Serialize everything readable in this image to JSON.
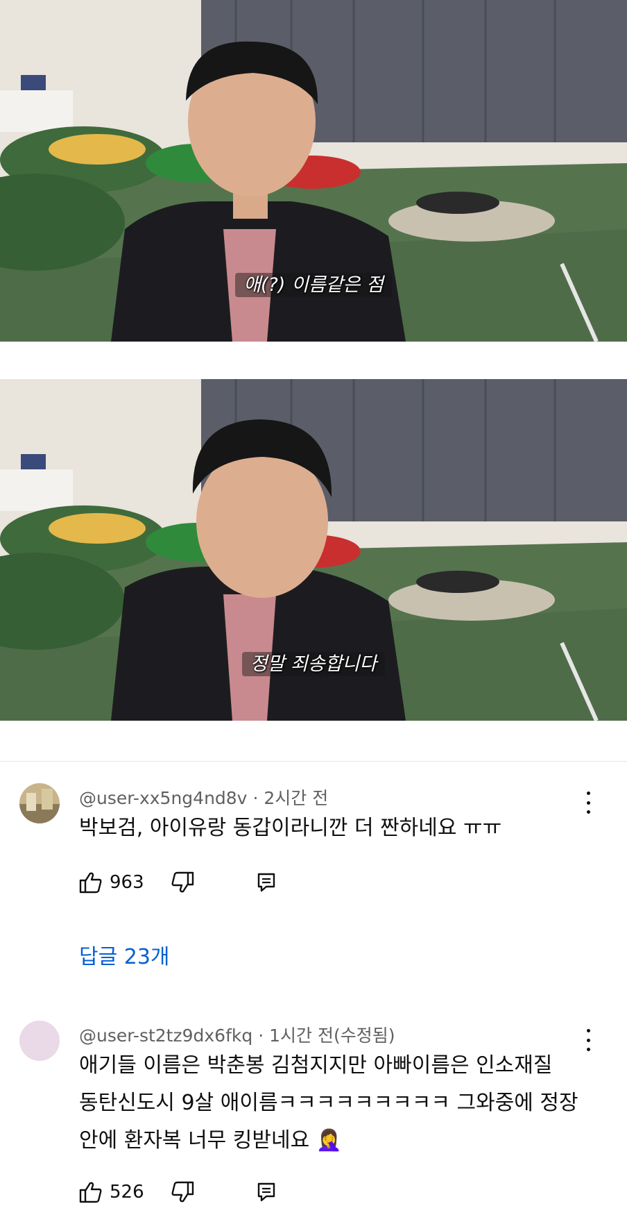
{
  "video_frames": [
    {
      "subtitle": "애(?) 이름같은 점"
    },
    {
      "subtitle": "정말 죄송합니다"
    }
  ],
  "comments": [
    {
      "author": "@user-xx5ng4nd8v",
      "separator": "·",
      "time": "2시간 전",
      "text_lines": [
        "박보검, 아이유랑 동갑이라니깐 더 짠하네요 ㅠㅠ"
      ],
      "likes": "963",
      "replies_label": "답글 23개"
    },
    {
      "author": "@user-st2tz9dx6fkq",
      "separator": "·",
      "time": "1시간 전(수정됨)",
      "text_lines": [
        "애기들 이름은 박춘봉 김첨지지만 아빠이름은 인소재질",
        "동탄신도시 9살 애이름ㅋㅋㅋㅋㅋㅋㅋㅋㅋ 그와중에 정장",
        "안에 환자복 너무 킹받네요 🤦‍♀️"
      ],
      "likes": "526"
    }
  ],
  "icons": {
    "like": "thumbs-up-icon",
    "dislike": "thumbs-down-icon",
    "reply": "reply-comment-icon",
    "more": "more-vert-icon"
  },
  "colors": {
    "link": "#065fd4",
    "meta": "#606060",
    "text": "#0f0f0f"
  }
}
